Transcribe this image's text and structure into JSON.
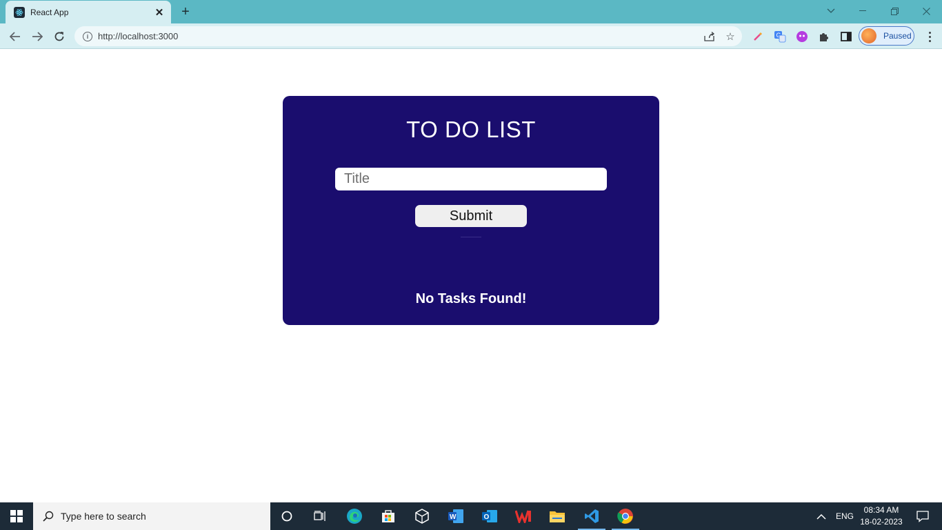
{
  "browser": {
    "tab_title": "React App",
    "url": "http://localhost:3000",
    "profile_label": "Paused"
  },
  "app": {
    "title": "TO DO LIST",
    "input_placeholder": "Title",
    "input_value": "",
    "submit_label": "Submit",
    "empty_message": "No Tasks Found!",
    "card_color": "#1a0d6e"
  },
  "taskbar": {
    "search_placeholder": "Type here to search",
    "language": "ENG",
    "time": "08:34 AM",
    "date": "18-02-2023"
  }
}
